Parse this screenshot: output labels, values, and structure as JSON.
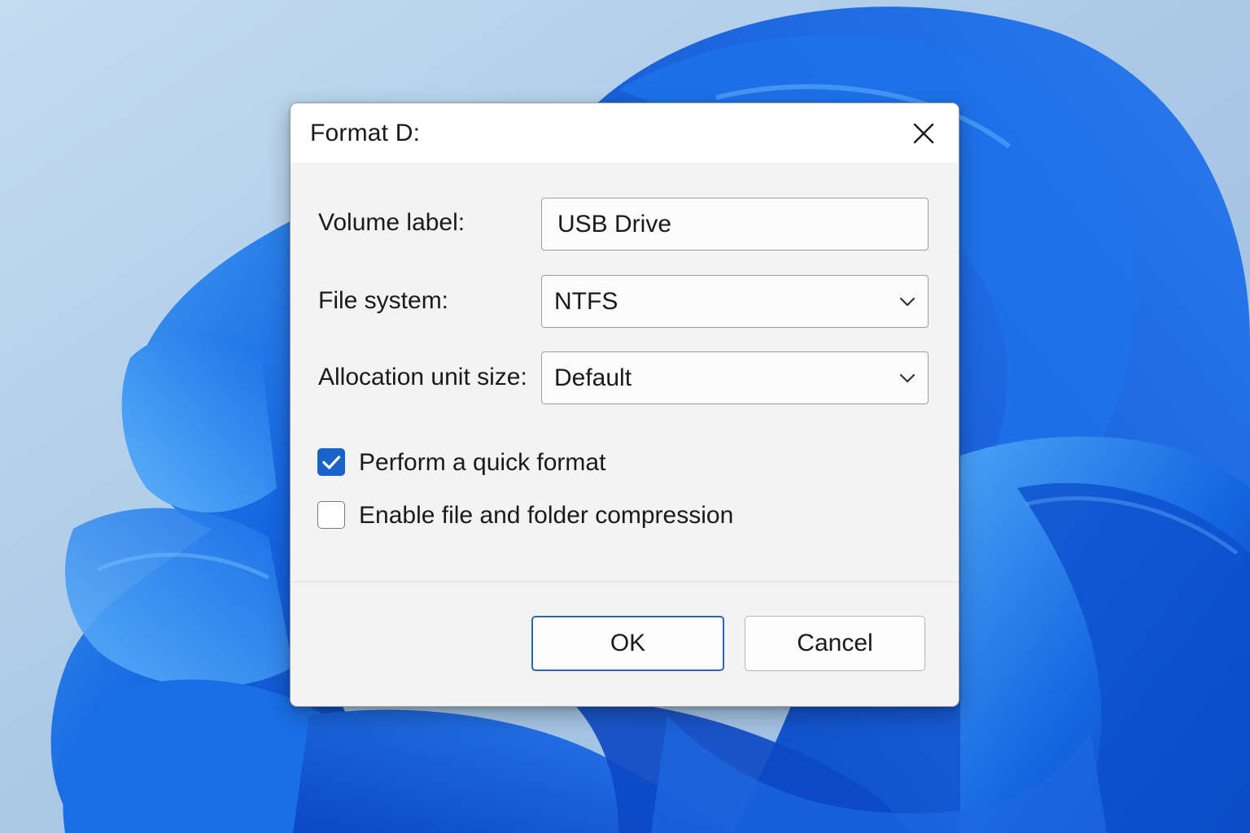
{
  "dialog": {
    "title": "Format D:",
    "close_icon": "close-icon"
  },
  "form": {
    "volume_label": {
      "label": "Volume label:",
      "value": "USB Drive"
    },
    "file_system": {
      "label": "File system:",
      "value": "NTFS",
      "icon": "chevron-down-icon"
    },
    "allocation_unit_size": {
      "label": "Allocation unit size:",
      "value": "Default",
      "icon": "chevron-down-icon"
    }
  },
  "options": {
    "quick_format": {
      "label": "Perform a quick format",
      "checked": true
    },
    "compression": {
      "label": "Enable file and folder compression",
      "checked": false
    }
  },
  "buttons": {
    "ok": "OK",
    "cancel": "Cancel"
  },
  "colors": {
    "accent": "#1964c8",
    "ok_border": "#2f63b8",
    "wallpaper_sky": "#aecbe6",
    "wallpaper_bloom": "#1565e0"
  }
}
